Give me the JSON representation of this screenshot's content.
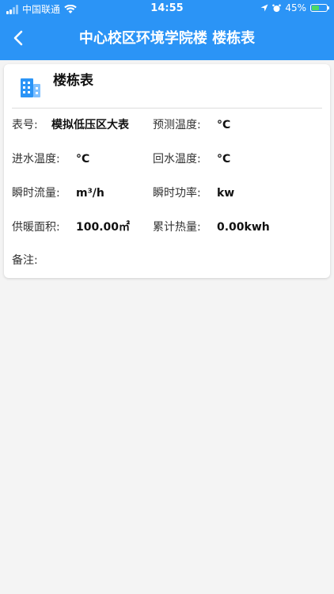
{
  "status_bar": {
    "carrier": "中国联通",
    "time": "14:55",
    "battery_percent": "45%",
    "battery_level": 0.45
  },
  "nav": {
    "title": "中心校区环境学院楼 楼栋表"
  },
  "card": {
    "title": "楼栋表",
    "fields": [
      {
        "label": "表号:",
        "value": "模拟低压区大表"
      },
      {
        "label": "预测温度:",
        "value": "°C"
      },
      {
        "label": "进水温度:",
        "value": "°C"
      },
      {
        "label": "回水温度:",
        "value": "°C"
      },
      {
        "label": "瞬时流量:",
        "value": "m³/h"
      },
      {
        "label": "瞬时功率:",
        "value": "kw"
      },
      {
        "label": "供暖面积:",
        "value": "100.00㎡"
      },
      {
        "label": "累计热量:",
        "value": "0.00kwh"
      },
      {
        "label": "备注:",
        "value": ""
      }
    ]
  },
  "colors": {
    "header_bg": "#2b94f6",
    "page_bg": "#f4f4f4",
    "card_bg": "#ffffff"
  }
}
